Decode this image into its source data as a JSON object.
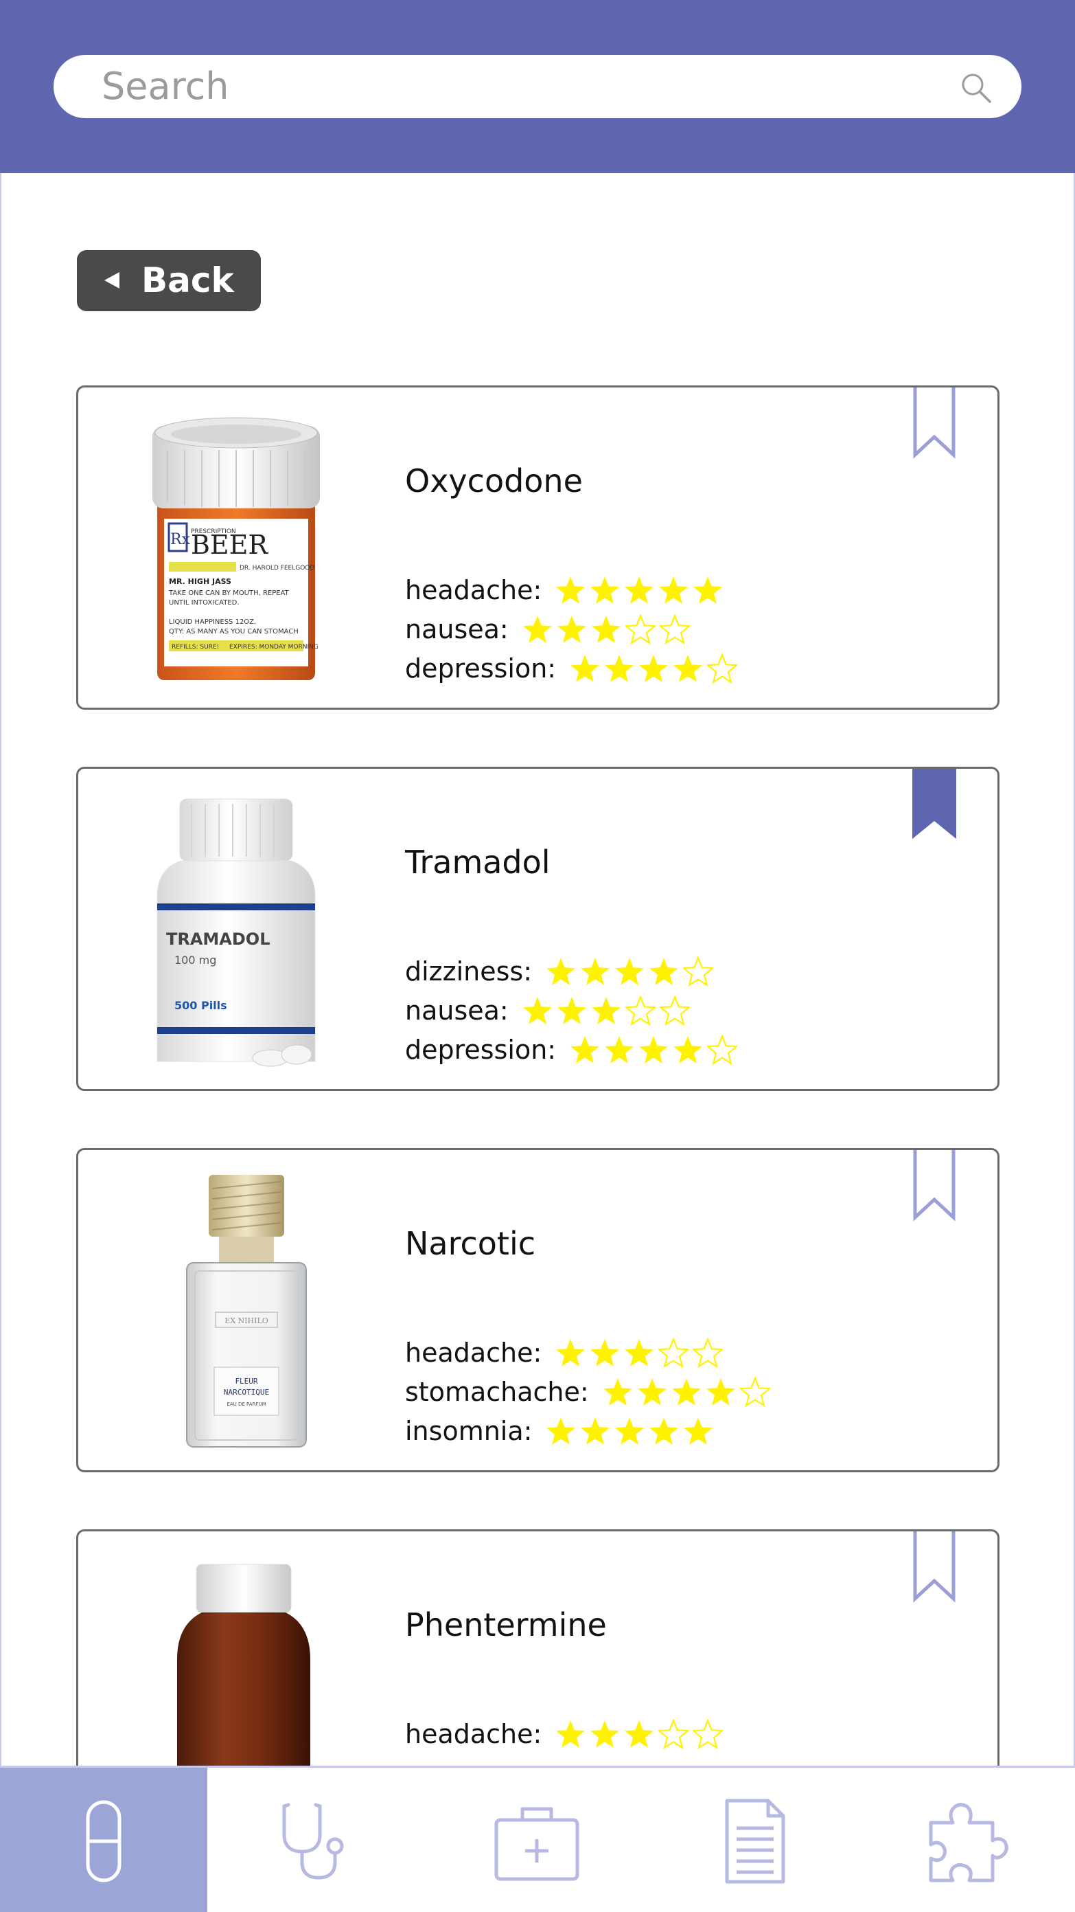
{
  "search": {
    "placeholder": "Search"
  },
  "back": {
    "label": "Back"
  },
  "colors": {
    "header": "#5f66b0",
    "star": "#fff200",
    "bookmark_active": "#5f66b0",
    "bookmark_outline": "#9aa0d6",
    "nav_active": "#9ca6d6",
    "nav_icon": "#b6bae0"
  },
  "drugs": [
    {
      "name": "Oxycodone",
      "image": "beer-pill-bottle-image",
      "bookmarked": false,
      "ratings": [
        {
          "label": "headache:",
          "stars": 5
        },
        {
          "label": "nausea:",
          "stars": 3
        },
        {
          "label": "depression:",
          "stars": 4
        }
      ],
      "image_label": {
        "rx": "Rx",
        "prescription": "PRESCRIPTION",
        "brand": "BEER",
        "doctor": "DR. HAROLD FEELGOOD",
        "patient": "MR. HIGH JASS",
        "line1": "TAKE ONE CAN BY MOUTH, REPEAT",
        "line2": "UNTIL INTOXICATED.",
        "line3": "LIQUID HAPPINESS 12OZ.",
        "line4": "QTY: AS MANY AS YOU CAN STOMACH",
        "refills": "REFILLS: SURE!",
        "expires": "EXPIRES: MONDAY MORNING"
      }
    },
    {
      "name": "Tramadol",
      "image": "tramadol-bottle-image",
      "bookmarked": true,
      "ratings": [
        {
          "label": "dizziness:",
          "stars": 4
        },
        {
          "label": "nausea:",
          "stars": 3
        },
        {
          "label": "depression:",
          "stars": 4
        }
      ],
      "image_label": {
        "title": "TRAMADOL",
        "dose": "100 mg",
        "count": "500 Pills"
      }
    },
    {
      "name": "Narcotic",
      "image": "perfume-bottle-image",
      "bookmarked": false,
      "ratings": [
        {
          "label": "headache:",
          "stars": 3
        },
        {
          "label": "stomachache:",
          "stars": 4
        },
        {
          "label": "insomnia:",
          "stars": 5
        }
      ],
      "image_label": {
        "brand": "EX NIHILO",
        "line1": "FLEUR",
        "line2": "NARCOTIQUE",
        "line3": "EAU DE PARFUM"
      }
    },
    {
      "name": "Phentermine",
      "image": "amber-bottle-image",
      "bookmarked": false,
      "ratings": [
        {
          "label": "headache:",
          "stars": 3
        }
      ]
    }
  ],
  "nav": [
    {
      "name": "nav-pills",
      "icon": "pill-icon",
      "active": true
    },
    {
      "name": "nav-doctor",
      "icon": "stethoscope-icon",
      "active": false
    },
    {
      "name": "nav-firstaid",
      "icon": "first-aid-kit-icon",
      "active": false
    },
    {
      "name": "nav-documents",
      "icon": "document-icon",
      "active": false
    },
    {
      "name": "nav-puzzle",
      "icon": "puzzle-icon",
      "active": false
    }
  ]
}
